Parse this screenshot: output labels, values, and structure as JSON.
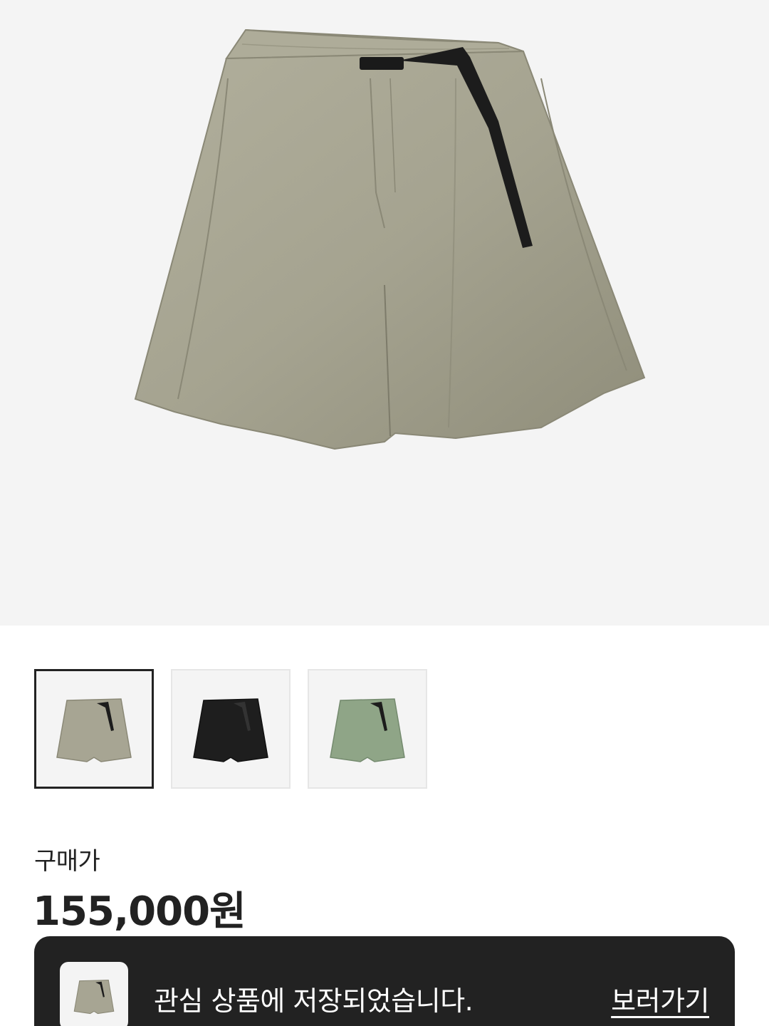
{
  "product": {
    "main_image": "shorts-beige-main",
    "selected_color": "#a7a593"
  },
  "thumbnails": [
    {
      "name": "beige",
      "color": "#a7a593",
      "selected": true
    },
    {
      "name": "black",
      "color": "#1e1e1e",
      "selected": false
    },
    {
      "name": "green",
      "color": "#8fa587",
      "selected": false
    }
  ],
  "price": {
    "label": "구매가",
    "value": "155,000원"
  },
  "toast": {
    "message": "관심 상품에 저장되었습니다.",
    "link": "보러가기"
  }
}
